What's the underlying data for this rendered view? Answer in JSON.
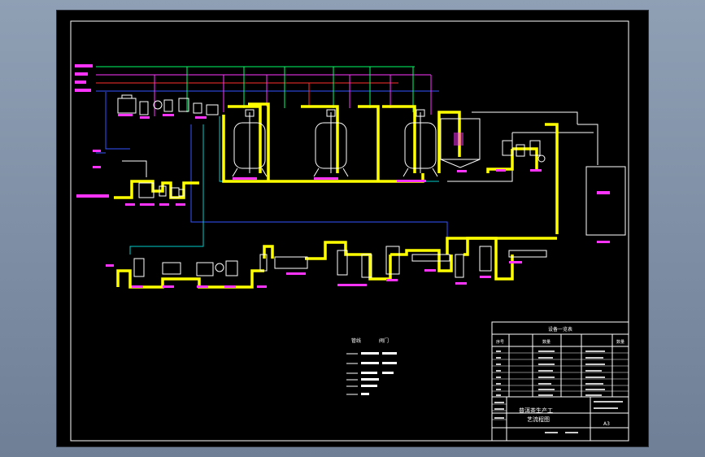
{
  "drawing": {
    "title_block": {
      "drawing_title_line1": "普洱茶生产工",
      "drawing_title_line2": "艺流程图",
      "sheet_size": "A3",
      "parts_list_header": "设备一览表",
      "col_no": "序号",
      "col_qty": "数量"
    },
    "legend": {
      "header_left": "管线",
      "header_right": "阀门"
    },
    "colors": {
      "product_line": "#ffff00",
      "steam_line": "#00ff66",
      "water_line": "#ff33ff",
      "cooling_line": "#00cccc",
      "vacuum_line": "#3355ff",
      "equipment_label": "#ff33ff",
      "frame": "#ffffff"
    },
    "icons": {
      "tank": "vessel-icon",
      "pump": "pump-icon",
      "filter": "filter-icon",
      "valve": "valve-icon"
    }
  }
}
